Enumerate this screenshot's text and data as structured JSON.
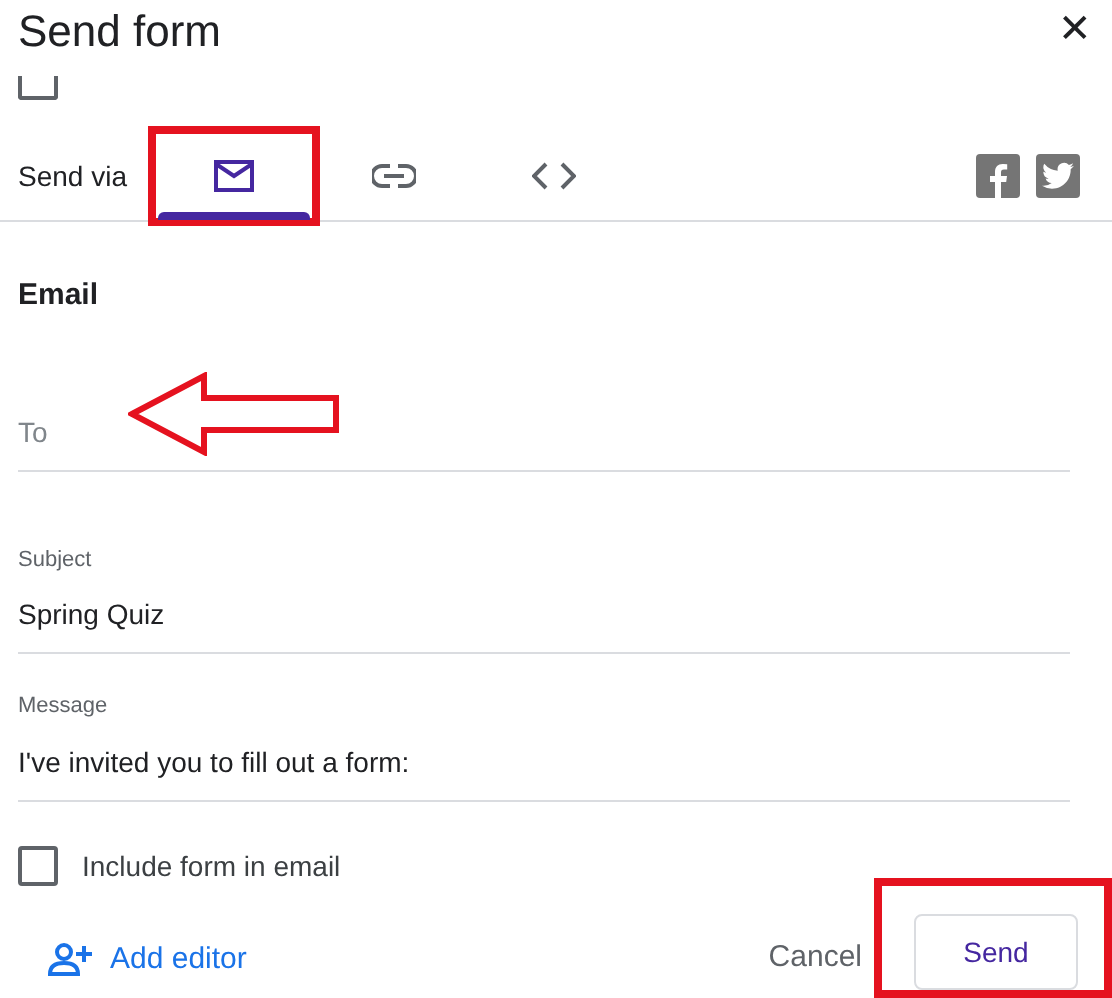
{
  "dialog": {
    "title": "Send form",
    "close_icon": "✕"
  },
  "collect_emails": {
    "checked": false
  },
  "send_via": {
    "label": "Send via",
    "tabs": [
      {
        "kind": "email",
        "selected": true,
        "highlighted": true
      },
      {
        "kind": "link",
        "selected": false,
        "highlighted": false
      },
      {
        "kind": "embed",
        "selected": false,
        "highlighted": false
      }
    ],
    "share": [
      {
        "kind": "facebook"
      },
      {
        "kind": "twitter"
      }
    ]
  },
  "email": {
    "heading": "Email",
    "fields": [
      {
        "placeholder": "To",
        "arrow": true
      },
      {
        "label": "Subject",
        "value": "Spring Quiz",
        "arrow": false
      },
      {
        "label": "Message",
        "value": "I've invited you to fill out a form:",
        "arrow": false
      }
    ],
    "include_form": {
      "label": "Include form in email",
      "checked": false
    }
  },
  "footer": {
    "add_editor": "Add editor",
    "cancel": "Cancel",
    "send": {
      "label": "Send",
      "highlighted": true
    }
  }
}
